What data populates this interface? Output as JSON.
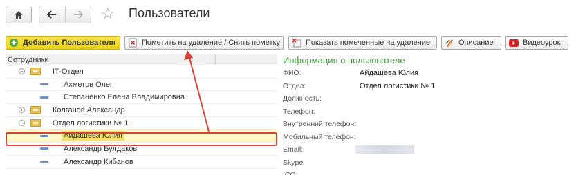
{
  "header": {
    "title": "Пользователи"
  },
  "toolbar": {
    "add_user": "Добавить Пользователя",
    "mark_delete": "Пометить на удаление / Снять пометку",
    "show_marked": "Показать помеченные на удаление",
    "description": "Описание",
    "video": "Видеоурок"
  },
  "tree": {
    "column": "Сотрудники",
    "rows": [
      {
        "label": "IT-Отдел",
        "type": "group",
        "state": "expanded"
      },
      {
        "label": "Ахметов Олег",
        "type": "user"
      },
      {
        "label": "Степаненко Елена Владимировна",
        "type": "user"
      },
      {
        "label": "Колганов Александр",
        "type": "group",
        "state": "collapsed"
      },
      {
        "label": "Отдел логистики № 1",
        "type": "group",
        "state": "expanded"
      },
      {
        "label": "Айдашева Юлия",
        "type": "user",
        "selected": true
      },
      {
        "label": "Александр Булдаков",
        "type": "user"
      },
      {
        "label": "Александр Кибанов",
        "type": "user"
      }
    ]
  },
  "info": {
    "title": "Информация о пользователе",
    "fields": [
      {
        "key": "ФИО:",
        "value": "Айдашева Юлия"
      },
      {
        "key": "Отдел:",
        "value": "Отдел логистики № 1"
      },
      {
        "key": "Должность:",
        "value": ""
      },
      {
        "key": "Телефон:",
        "value": ""
      },
      {
        "key": "Внутренний телефон:",
        "value": ""
      },
      {
        "key": "Мобильный телефон:",
        "value": ""
      },
      {
        "key": "Email:",
        "value": ""
      },
      {
        "key": "Skype:",
        "value": ""
      },
      {
        "key": "ICQ:",
        "value": ""
      }
    ]
  },
  "colors": {
    "accent_green": "#3a9a3a",
    "primary_button": "#ead31c",
    "highlight_red": "#d9413a"
  }
}
